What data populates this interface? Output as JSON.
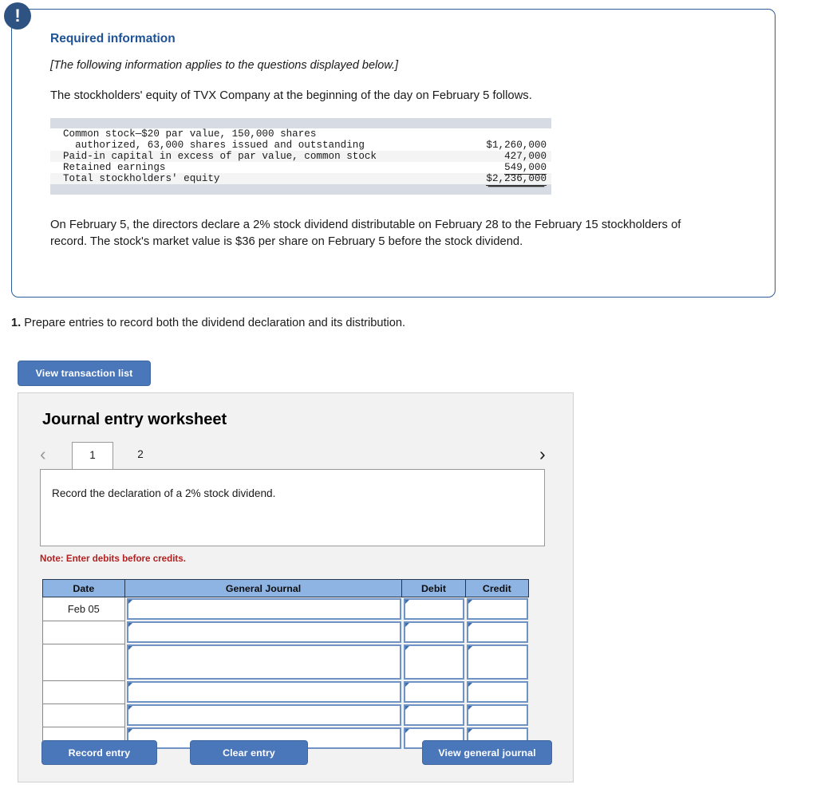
{
  "callout": {
    "icon": "alert-exclamation-icon",
    "icon_glyph": "!",
    "title": "Required information",
    "italic_note": "[The following information applies to the questions displayed below.]",
    "lead": "The stockholders' equity of TVX Company at the beginning of the day on February 5 follows.",
    "closing_paragraph": "On February 5, the directors declare a 2% stock dividend distributable on February 28 to the February 15 stockholders of record. The stock's market value is $36 per share on February 5 before the stock dividend."
  },
  "equity_table": {
    "rows": [
      {
        "label": "Common stock—$20 par value, 150,000 shares",
        "amount": ""
      },
      {
        "label": "  authorized, 63,000 shares issued and outstanding",
        "amount": "$1,260,000"
      },
      {
        "label": "Paid-in capital in excess of par value, common stock",
        "amount": "427,000"
      },
      {
        "label": "Retained earnings",
        "amount": "549,000"
      },
      {
        "label": "Total stockholders' equity",
        "amount": "$2,236,000"
      }
    ]
  },
  "question": {
    "number": "1.",
    "text": " Prepare entries to record both the dividend declaration and its distribution."
  },
  "buttons": {
    "view_transaction_list": "View transaction list",
    "record_entry": "Record entry",
    "clear_entry": "Clear entry",
    "view_general_journal": "View general journal"
  },
  "worksheet": {
    "title": "Journal entry worksheet",
    "prev_icon": "chevron-left-icon",
    "prev_glyph": "‹",
    "next_icon": "chevron-right-icon",
    "next_glyph": "›",
    "tabs": [
      {
        "label": "1",
        "active": true
      },
      {
        "label": "2",
        "active": false
      }
    ],
    "description": "Record the declaration of a 2% stock dividend.",
    "note": "Note: Enter debits before credits.",
    "columns": [
      "Date",
      "General Journal",
      "Debit",
      "Credit"
    ],
    "rows": [
      {
        "date": "Feb 05",
        "general_journal": "",
        "debit": "",
        "credit": ""
      },
      {
        "date": "",
        "general_journal": "",
        "debit": "",
        "credit": ""
      },
      {
        "date": "",
        "general_journal": "",
        "debit": "",
        "credit": ""
      },
      {
        "date": "",
        "general_journal": "",
        "debit": "",
        "credit": ""
      },
      {
        "date": "",
        "general_journal": "",
        "debit": "",
        "credit": ""
      },
      {
        "date": "",
        "general_journal": "",
        "debit": "",
        "credit": ""
      }
    ]
  },
  "colors": {
    "accent_blue": "#4a76ba",
    "callout_border": "#2c5d9b",
    "heading_blue": "#1f5395",
    "note_red": "#b32020",
    "table_header_blue": "#8eb4e3",
    "strip_gray": "#d6dbe4"
  }
}
